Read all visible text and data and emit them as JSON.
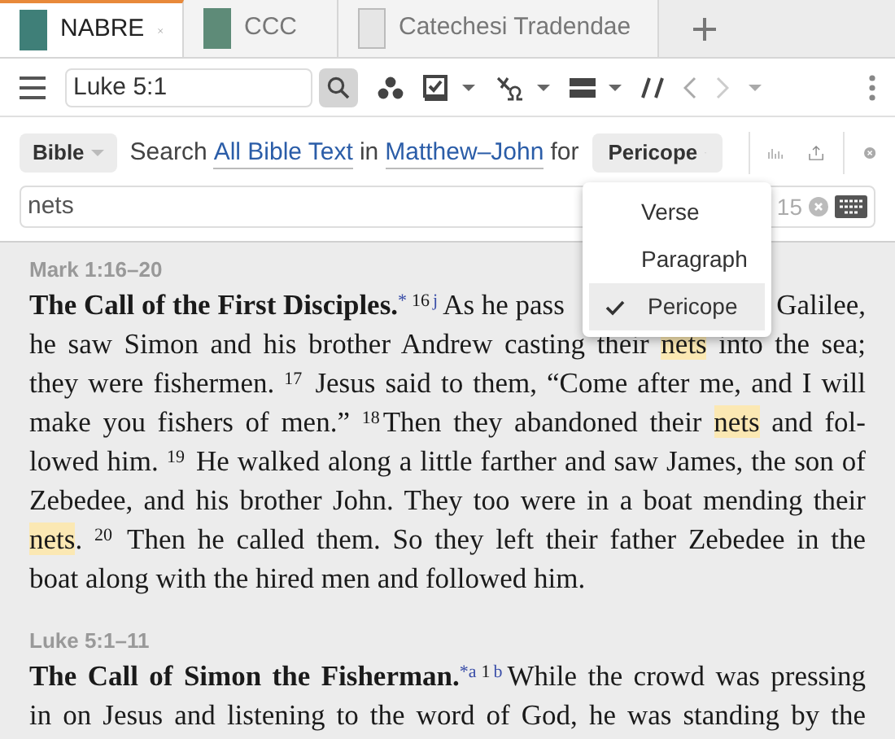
{
  "tabs": [
    {
      "label": "NABRE",
      "selected": true
    },
    {
      "label": "CCC",
      "selected": false
    },
    {
      "label": "Catechesi Tradendae",
      "selected": false
    }
  ],
  "toolbar": {
    "reference": {
      "value": "Luke 5:1"
    }
  },
  "search": {
    "scope": "Bible",
    "sentence": [
      {
        "kind": "text",
        "text": "Search"
      },
      {
        "kind": "link",
        "text": "All Bible Text"
      },
      {
        "kind": "text",
        "text": "in"
      },
      {
        "kind": "link",
        "text": "Matthew–John"
      },
      {
        "kind": "text",
        "text": "for"
      }
    ],
    "unit": "Pericope",
    "field": {
      "value": "nets"
    },
    "count": "15"
  },
  "menu": [
    {
      "label": "Verse",
      "selected": false
    },
    {
      "label": "Paragraph",
      "selected": false
    },
    {
      "label": "Pericope",
      "selected": true
    }
  ],
  "passages": [
    {
      "reference": "Mark 1:16–20",
      "lines": [
        {
          "segments": [
            {
              "kind": "title",
              "text": "The Call of the First Disciples."
            },
            {
              "kind": "note",
              "text": "*"
            },
            {
              "kind": "verse",
              "text": "16"
            },
            {
              "kind": "note",
              "text": "j"
            },
            {
              "kind": "text",
              "text": "As he pass"
            }
          ],
          "tail": [
            {
              "kind": "text",
              "text": "Galilee,"
            }
          ]
        },
        {
          "segments": [
            {
              "kind": "text",
              "text": "he saw Simon and his brother Andrew casting their "
            },
            {
              "kind": "hit",
              "text": "nets"
            },
            {
              "kind": "text",
              "text": " into the sea;"
            }
          ]
        },
        {
          "segments": [
            {
              "kind": "text",
              "text": "they were fishermen. "
            },
            {
              "kind": "verse",
              "text": "17"
            },
            {
              "kind": "text",
              "text": " Jesus said to them, “Come after me, and I will"
            }
          ]
        },
        {
          "segments": [
            {
              "kind": "text",
              "text": "make you fishers of men.” "
            },
            {
              "kind": "verse",
              "text": "18"
            },
            {
              "kind": "text",
              "text": "Then they abandoned their "
            },
            {
              "kind": "hit",
              "text": "nets"
            },
            {
              "kind": "text",
              "text": " and fol-"
            }
          ]
        },
        {
          "segments": [
            {
              "kind": "text",
              "text": "lowed him. "
            },
            {
              "kind": "verse",
              "text": "19"
            },
            {
              "kind": "text",
              "text": " He walked along a little farther and saw James, the son of"
            }
          ]
        },
        {
          "segments": [
            {
              "kind": "text",
              "text": "Zebedee, and his brother John. They too were in a boat mending their"
            }
          ]
        },
        {
          "segments": [
            {
              "kind": "hit",
              "text": "nets"
            },
            {
              "kind": "text",
              "text": ". "
            },
            {
              "kind": "verse",
              "text": "20"
            },
            {
              "kind": "text",
              "text": " Then he called them. So they left their father Zebedee in the"
            }
          ]
        },
        {
          "segments": [
            {
              "kind": "text",
              "text": "boat along with the hired men and followed him."
            }
          ]
        }
      ]
    },
    {
      "reference": "Luke 5:1–11",
      "lines": [
        {
          "segments": [
            {
              "kind": "title",
              "text": "The Call of Simon the Fisherman."
            },
            {
              "kind": "note",
              "text": "*a"
            },
            {
              "kind": "verse",
              "text": "1"
            },
            {
              "kind": "note",
              "text": "b"
            },
            {
              "kind": "text",
              "text": "While the crowd was pressing"
            }
          ]
        },
        {
          "segments": [
            {
              "kind": "text",
              "text": "in on Jesus and listening to the word of God, he was standing by the"
            }
          ]
        }
      ]
    }
  ]
}
